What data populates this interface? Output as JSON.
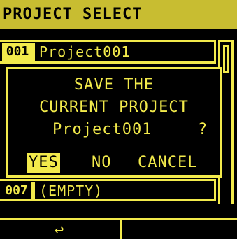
{
  "header": {
    "title": "PROJECT SELECT"
  },
  "list": {
    "items": [
      {
        "number": "001",
        "name": "Project001",
        "selected": true
      },
      {
        "number": "007",
        "name": "(EMPTY)",
        "selected": false
      }
    ]
  },
  "dialog": {
    "line1": "SAVE THE",
    "line2": "CURRENT PROJECT",
    "project_name": "Project001",
    "question_mark": "?",
    "buttons": {
      "yes": "YES",
      "no": "NO",
      "cancel": "CANCEL"
    },
    "selected_button": "yes"
  },
  "footer": {
    "return_icon": "return-arrow-icon",
    "return_glyph": "↩"
  },
  "colors": {
    "accent": "#f2ea4b",
    "title_bar": "#c8bd31",
    "background": "#000000"
  }
}
